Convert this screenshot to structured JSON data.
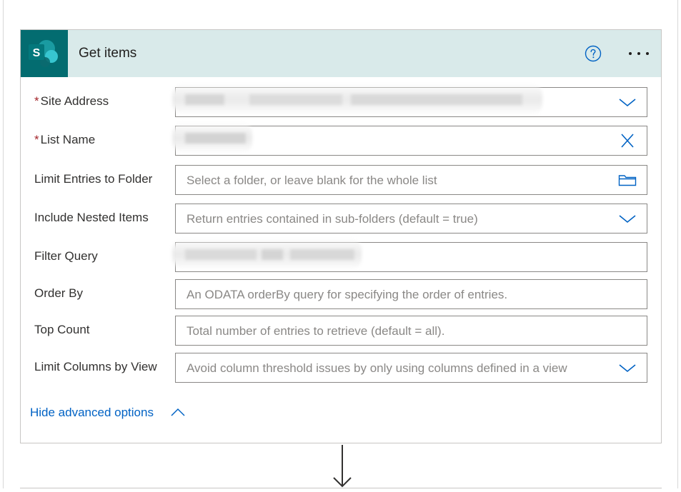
{
  "action": {
    "title": "Get items",
    "connector_icon": "sharepoint-logo",
    "help_icon": "help-circle-icon",
    "menu_icon": "more-ellipsis-icon",
    "brand_color": "#036c70",
    "header_color": "#d9eaea"
  },
  "fields": [
    {
      "label": "Site Address",
      "required": "*",
      "value": "",
      "placeholder": "",
      "control_icon": "chevron-down-icon"
    },
    {
      "label": "List Name",
      "required": "*",
      "value": "",
      "placeholder": "",
      "control_icon": "close-icon"
    },
    {
      "label": "Limit Entries to Folder",
      "value": "",
      "placeholder": "Select a folder, or leave blank for the whole list",
      "control_icon": "folder-icon"
    },
    {
      "label": "Include Nested Items",
      "value": "",
      "placeholder": "Return entries contained in sub-folders (default = true)",
      "control_icon": "chevron-down-icon"
    },
    {
      "label": "Filter Query",
      "value": "",
      "placeholder": ""
    },
    {
      "label": "Order By",
      "value": "",
      "placeholder": "An ODATA orderBy query for specifying the order of entries."
    },
    {
      "label": "Top Count",
      "value": "",
      "placeholder": "Total number of entries to retrieve (default = all)."
    },
    {
      "label": "Limit Columns by View",
      "value": "",
      "placeholder": "Avoid column threshold issues by only using columns defined in a view",
      "control_icon": "chevron-down-icon"
    }
  ],
  "advanced_toggle": {
    "label": "Hide advanced options",
    "icon": "chevron-up-icon"
  },
  "connector_arrow": "arrow-down-icon",
  "accent_color": "#0062c4"
}
